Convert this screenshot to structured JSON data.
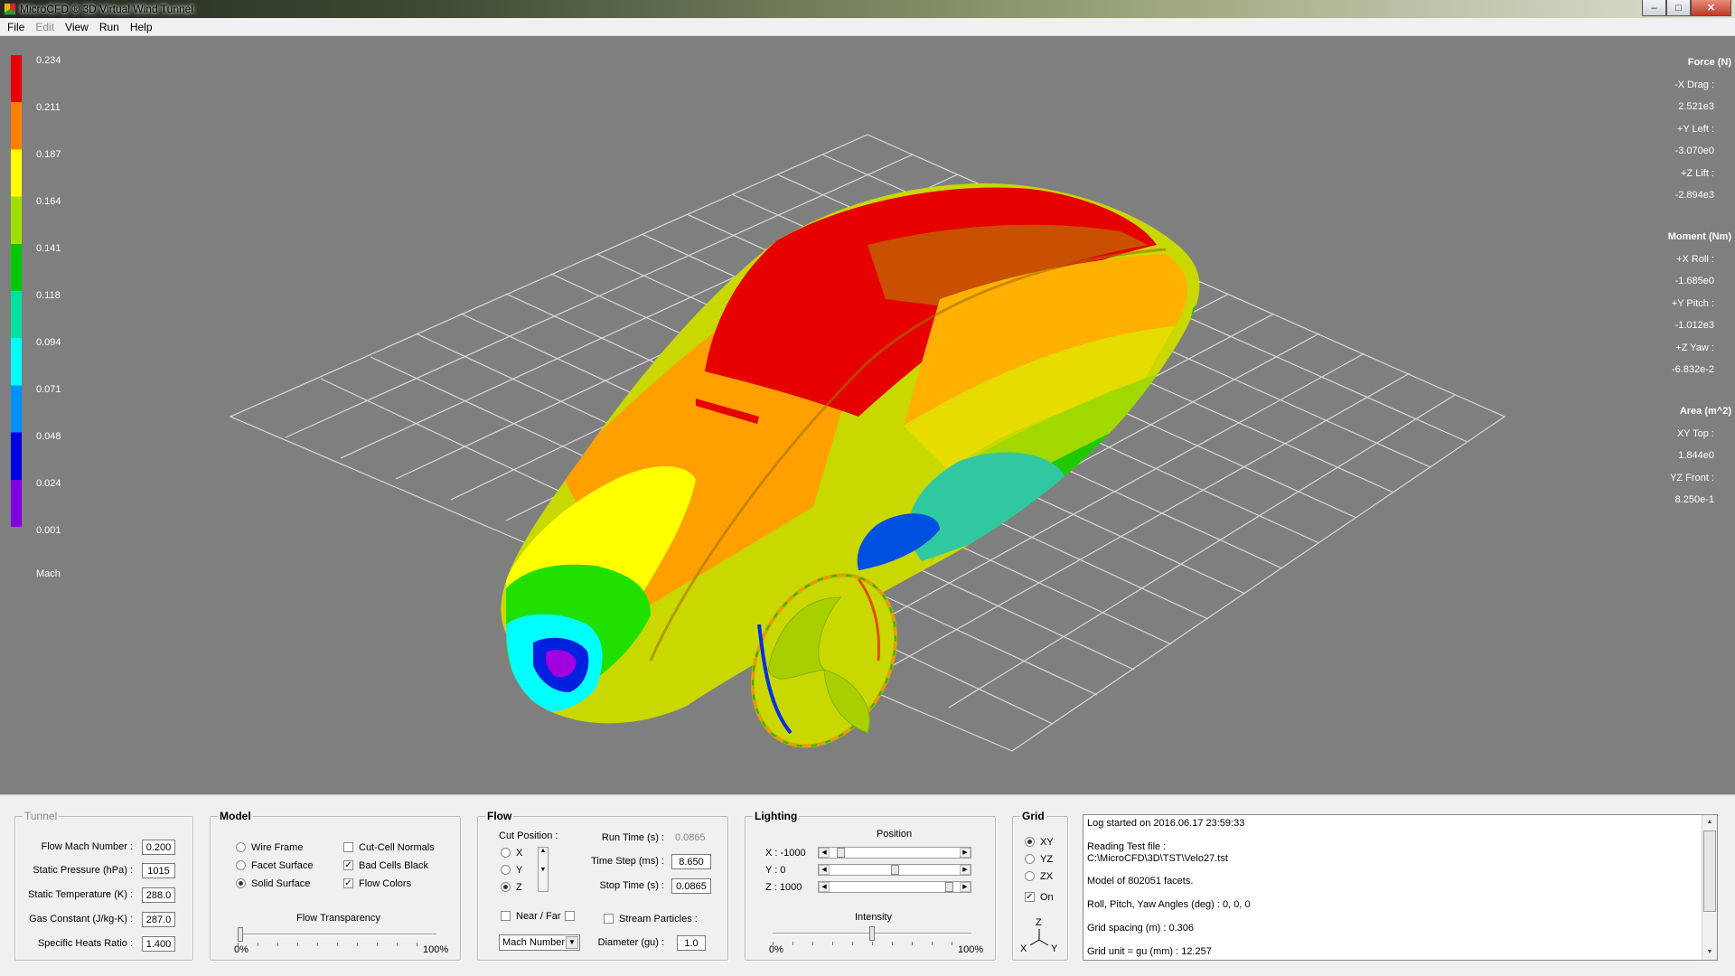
{
  "window": {
    "title": "MicroCFD ® 3D Virtual Wind Tunnel",
    "minimize": "–",
    "maximize": "□",
    "close": "✕"
  },
  "menu": {
    "file": "File",
    "edit": "Edit",
    "view": "View",
    "run": "Run",
    "help": "Help"
  },
  "legend": {
    "labels": [
      "0.234",
      "0.211",
      "0.187",
      "0.164",
      "0.141",
      "0.118",
      "0.094",
      "0.071",
      "0.048",
      "0.024",
      "0.001"
    ],
    "unit": "Mach"
  },
  "results": {
    "force_title": "Force (N)",
    "drag_label": "-X  Drag :",
    "drag_value": "2.521e3",
    "left_label": "+Y  Left :",
    "left_value": "-3.070e0",
    "lift_label": "+Z  Lift :",
    "lift_value": "-2.894e3",
    "moment_title": "Moment (Nm)",
    "roll_label": "+X  Roll :",
    "roll_value": "-1.685e0",
    "pitch_label": "+Y  Pitch :",
    "pitch_value": "-1.012e3",
    "yaw_label": "+Z  Yaw :",
    "yaw_value": "-6.832e-2",
    "area_title": "Area (m^2)",
    "top_label": "XY  Top :",
    "top_value": "1.844e0",
    "front_label": "YZ  Front :",
    "front_value": "8.250e-1"
  },
  "tunnel": {
    "title": "Tunnel",
    "mach_label": "Flow Mach Number :",
    "mach_value": "0.200",
    "pressure_label": "Static Pressure (hPa) :",
    "pressure_value": "1015",
    "temperature_label": "Static Temperature (K) :",
    "temperature_value": "288.0",
    "gas_label": "Gas Constant (J/kg-K) :",
    "gas_value": "287.0",
    "heats_label": "Specific Heats Ratio :",
    "heats_value": "1.400"
  },
  "model": {
    "title": "Model",
    "wire_frame": "Wire Frame",
    "facet_surface": "Facet Surface",
    "solid_surface": "Solid Surface",
    "cut_cell_normals": "Cut-Cell Normals",
    "bad_cells_black": "Bad Cells Black",
    "flow_colors": "Flow Colors",
    "transparency_label": "Flow Transparency",
    "min_label": "0%",
    "max_label": "100%"
  },
  "flow": {
    "title": "Flow",
    "cut_position": "Cut Position :",
    "x": "X",
    "y": "Y",
    "z": "Z",
    "near_far": "Near / Far",
    "run_time_label": "Run Time (s) :",
    "run_time_value": "0.0865",
    "time_step_label": "Time Step (ms) :",
    "time_step_value": "8.650",
    "stop_time_label": "Stop Time (s) :",
    "stop_time_value": "0.0865",
    "stream_particles": "Stream Particles :",
    "diameter_label": "Diameter (gu) :",
    "diameter_value": "1.0",
    "variable": "Mach Number"
  },
  "lighting": {
    "title": "Lighting",
    "position_label": "Position",
    "x_label": "X  :  -1000",
    "y_label": "Y  :  0",
    "z_label": "Z  :  1000",
    "intensity_label": "Intensity",
    "min_label": "0%",
    "max_label": "100%"
  },
  "grid": {
    "title": "Grid",
    "xy": "XY",
    "yz": "YZ",
    "zx": "ZX",
    "on": "On",
    "axis_z": "Z",
    "axis_x": "X",
    "axis_y": "Y"
  },
  "log": {
    "lines": [
      "Log started on 2016.06.17 23:59:33",
      "Reading Test file :",
      "C:\\MicroCFD\\3D\\TST\\Velo27.tst",
      "Model of 802051 facets.",
      "Roll, Pitch, Yaw Angles (deg) : 0, 0, 0",
      "Grid spacing (m) : 0.306",
      "Grid unit = gu (mm) : 12.257"
    ]
  },
  "colors": {
    "viewport": "#7f7f7f",
    "grid_lines": "#d9d9d9",
    "mach_scale": [
      "#e60000",
      "#ff8000",
      "#ffff00",
      "#a0e000",
      "#00c800",
      "#00e0a0",
      "#00ffff",
      "#0090ff",
      "#0000e0",
      "#8000e0"
    ]
  }
}
